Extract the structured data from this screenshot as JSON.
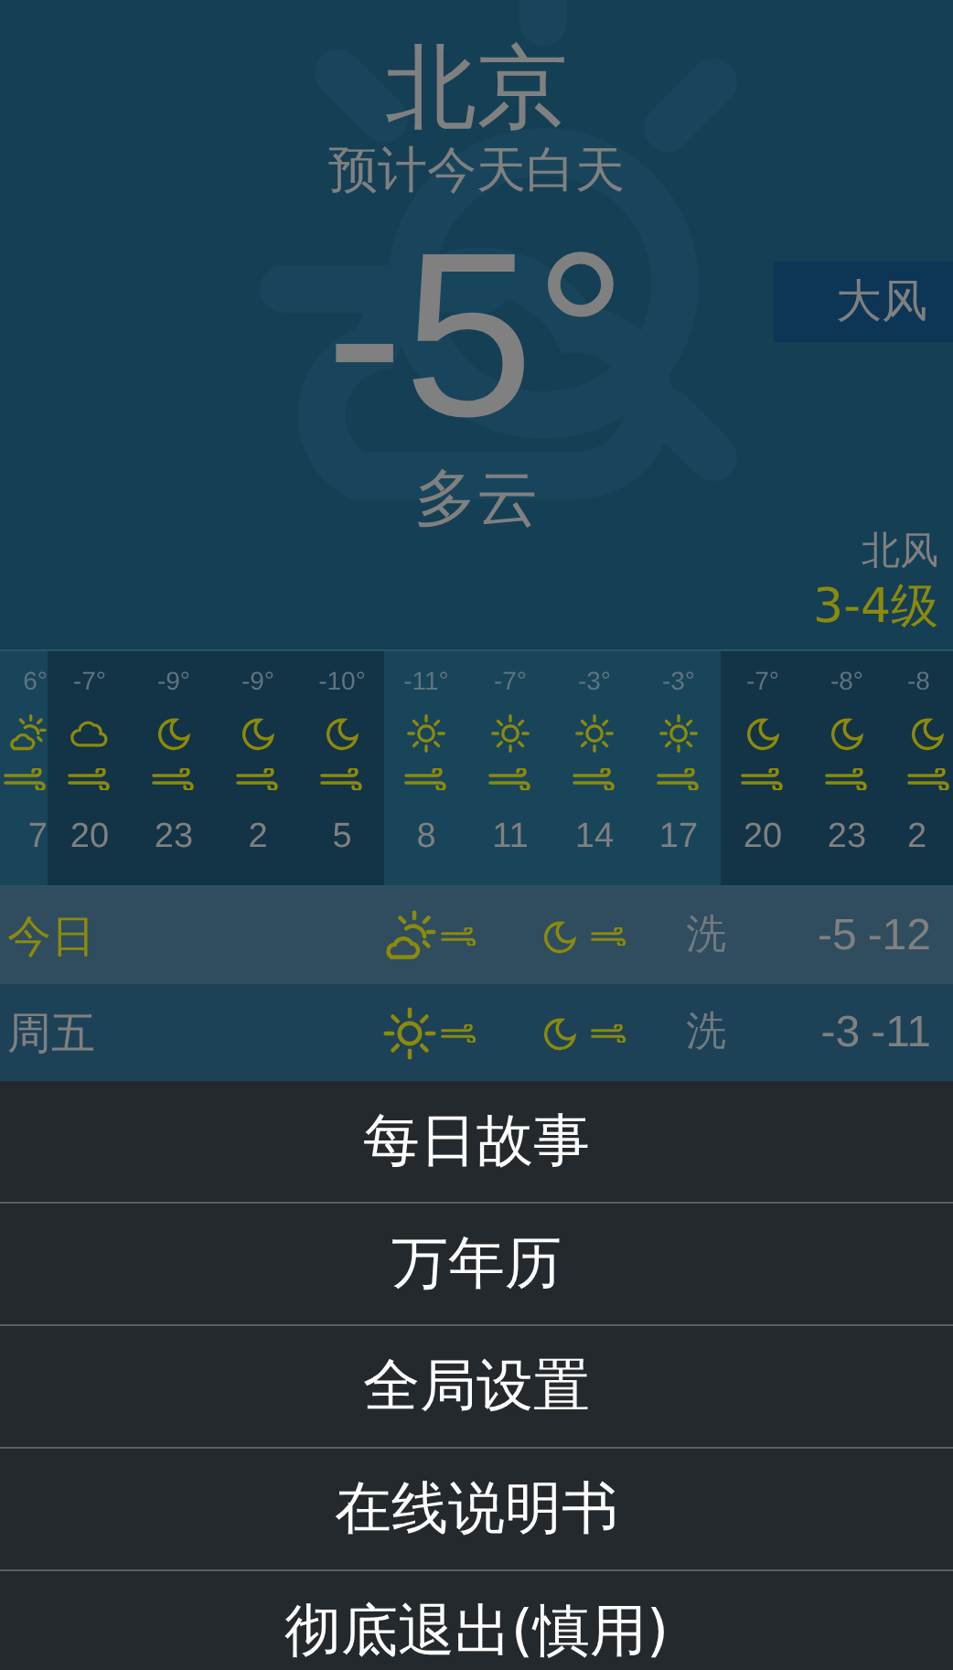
{
  "city": "北京",
  "forecast_label": "预计今天白天",
  "temperature": "-5°",
  "condition": "多云",
  "alert_badge": "大风",
  "wind": {
    "direction": "北风",
    "force": "3-4级"
  },
  "hourly": [
    {
      "temp": "6°",
      "kind": "partly",
      "hour": "7",
      "shaded": false
    },
    {
      "temp": "-7°",
      "kind": "cloudy",
      "hour": "20",
      "shaded": true
    },
    {
      "temp": "-9°",
      "kind": "moon",
      "hour": "23",
      "shaded": true
    },
    {
      "temp": "-9°",
      "kind": "moon",
      "hour": "2",
      "shaded": true
    },
    {
      "temp": "-10°",
      "kind": "moon",
      "hour": "5",
      "shaded": true
    },
    {
      "temp": "-11°",
      "kind": "sun",
      "hour": "8",
      "shaded": false
    },
    {
      "temp": "-7°",
      "kind": "sun",
      "hour": "11",
      "shaded": false
    },
    {
      "temp": "-3°",
      "kind": "sun",
      "hour": "14",
      "shaded": false
    },
    {
      "temp": "-3°",
      "kind": "sun",
      "hour": "17",
      "shaded": false
    },
    {
      "temp": "-7°",
      "kind": "moon",
      "hour": "20",
      "shaded": true
    },
    {
      "temp": "-8°",
      "kind": "moon",
      "hour": "23",
      "shaded": true
    },
    {
      "temp": "-8",
      "kind": "moon",
      "hour": "2",
      "shaded": true
    }
  ],
  "daily": [
    {
      "day": "今日",
      "daytime": {
        "kind": "partly"
      },
      "night": {
        "kind": "moon"
      },
      "wash": "洗",
      "high": "-5",
      "low": "-12",
      "selected": true
    },
    {
      "day": "周五",
      "daytime": {
        "kind": "sun"
      },
      "night": {
        "kind": "moon"
      },
      "wash": "洗",
      "high": "-3",
      "low": "-11",
      "selected": false
    }
  ],
  "menu": [
    "每日故事",
    "万年历",
    "全局设置",
    "在线说明书",
    "彻底退出(慎用)"
  ]
}
